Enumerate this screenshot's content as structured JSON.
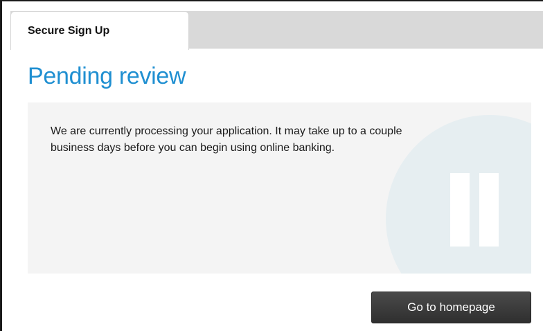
{
  "tabs": {
    "active_label": "Secure Sign Up"
  },
  "page": {
    "title": "Pending review",
    "message": "We are currently processing your application. It may take up to a couple business days before you can begin using online banking."
  },
  "actions": {
    "home_label": "Go to homepage"
  },
  "icons": {
    "status_icon": "pause-icon"
  },
  "colors": {
    "title": "#1f8fd1",
    "panel_background": "#f4f4f4",
    "button_background": "#3a3a3a",
    "tab_strip": "#d9d9d9"
  }
}
